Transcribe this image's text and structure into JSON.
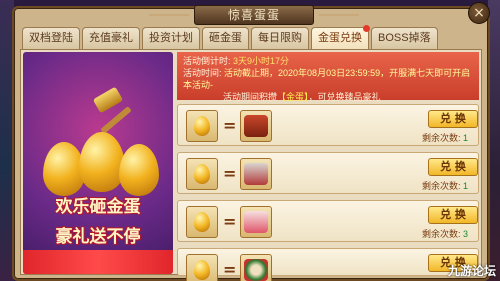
{
  "window": {
    "title": "惊喜蛋蛋",
    "close_icon": "×"
  },
  "tabs": [
    {
      "label": "双档登陆"
    },
    {
      "label": "充值豪礼"
    },
    {
      "label": "投资计划"
    },
    {
      "label": "砸金蛋"
    },
    {
      "label": "每日限购"
    },
    {
      "label": "金蛋兑换",
      "active": true,
      "has_badge": true
    },
    {
      "label": "BOSS掉落"
    }
  ],
  "banner": {
    "line1": "欢乐砸金蛋",
    "line2": "豪礼送不停"
  },
  "info": {
    "countdown_label": "活动倒计时:",
    "countdown_value": "3天9小时17分",
    "period_label": "活动时间:",
    "period_text": "活动截止期，2020年08月03日23:59:59，开服满七天即可开启本活动-",
    "desc_pre": "活动期间积攒",
    "desc_tag": "【金蛋】",
    "desc_post": "，可兑换臻品豪礼"
  },
  "rows": [
    {
      "egg_label": "金蛋",
      "reward": "treasure-chest-icon",
      "button": "兑 换",
      "remain_label": "剩余次数:",
      "remain_value": "1"
    },
    {
      "egg_label": "金蛋",
      "reward": "hero-portrait-icon",
      "button": "兑 换",
      "remain_label": "剩余次数:",
      "remain_value": "1"
    },
    {
      "egg_label": "金蛋",
      "reward": "gift-box-icon",
      "button": "兑 换",
      "remain_label": "剩余次数:",
      "remain_value": "3"
    },
    {
      "egg_label": "金蛋",
      "reward": "wreath-icon",
      "button": "兑 换",
      "remain_label": "",
      "remain_value": ""
    }
  ],
  "watermark": "九游论坛"
}
